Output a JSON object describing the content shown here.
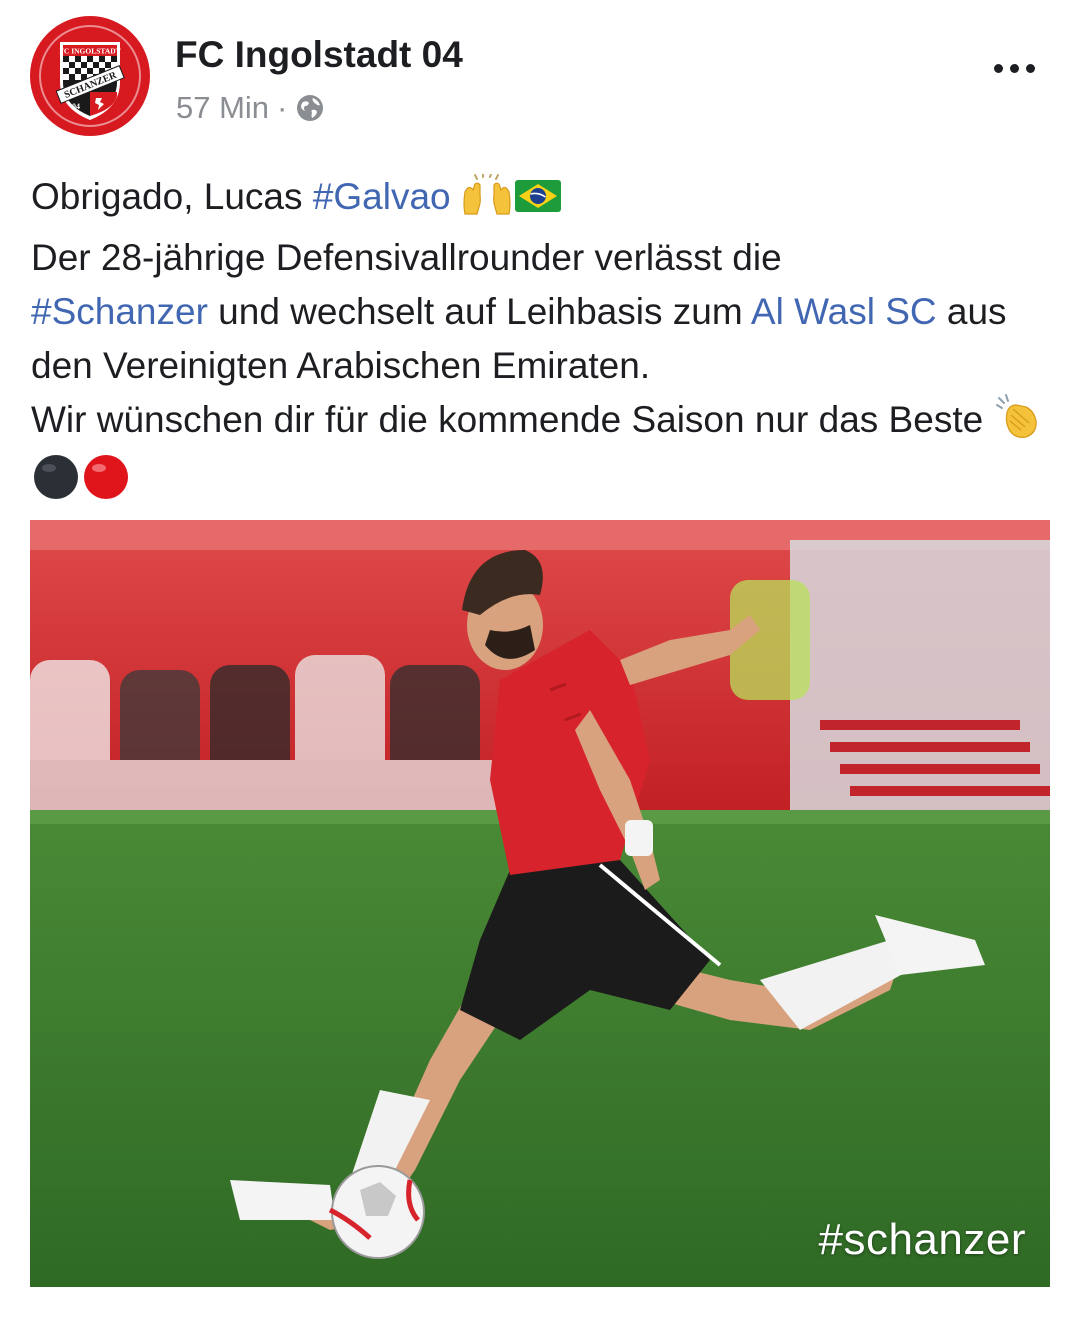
{
  "post": {
    "page_name": "FC Ingolstadt 04",
    "time": "57 Min",
    "separator": "·",
    "privacy_icon": "globe-icon",
    "more_icon": "more-horizontal-icon",
    "logo": {
      "top_text": "FC INGOLSTADT",
      "band_text": "SCHANZER",
      "year_text": "04"
    },
    "text": {
      "line1_prefix": "Obrigado, Lucas ",
      "hashtag_galvao": "#Galvao",
      "line2": "Der 28-jährige Defensivallrounder verlässt die",
      "hashtag_schanzer": "#Schanzer",
      "line3_middle": " und wechselt auf Leihbasis zum ",
      "al_wasl_link": "Al Wasl SC",
      "line4_suffix": " aus den Vereinigten Arabischen Emiraten.",
      "line5": "Wir wünschen dir für die kommende Saison nur das Beste "
    },
    "emojis": [
      "raising-hands-emoji",
      "brazil-flag-emoji",
      "clapping-hands-emoji",
      "black-circle-emoji",
      "red-circle-emoji"
    ],
    "photo": {
      "watermark": "#schanzer"
    }
  },
  "colors": {
    "link": "#4267b2",
    "club_red": "#d71920",
    "pitch_green": "#3f7a2f"
  }
}
